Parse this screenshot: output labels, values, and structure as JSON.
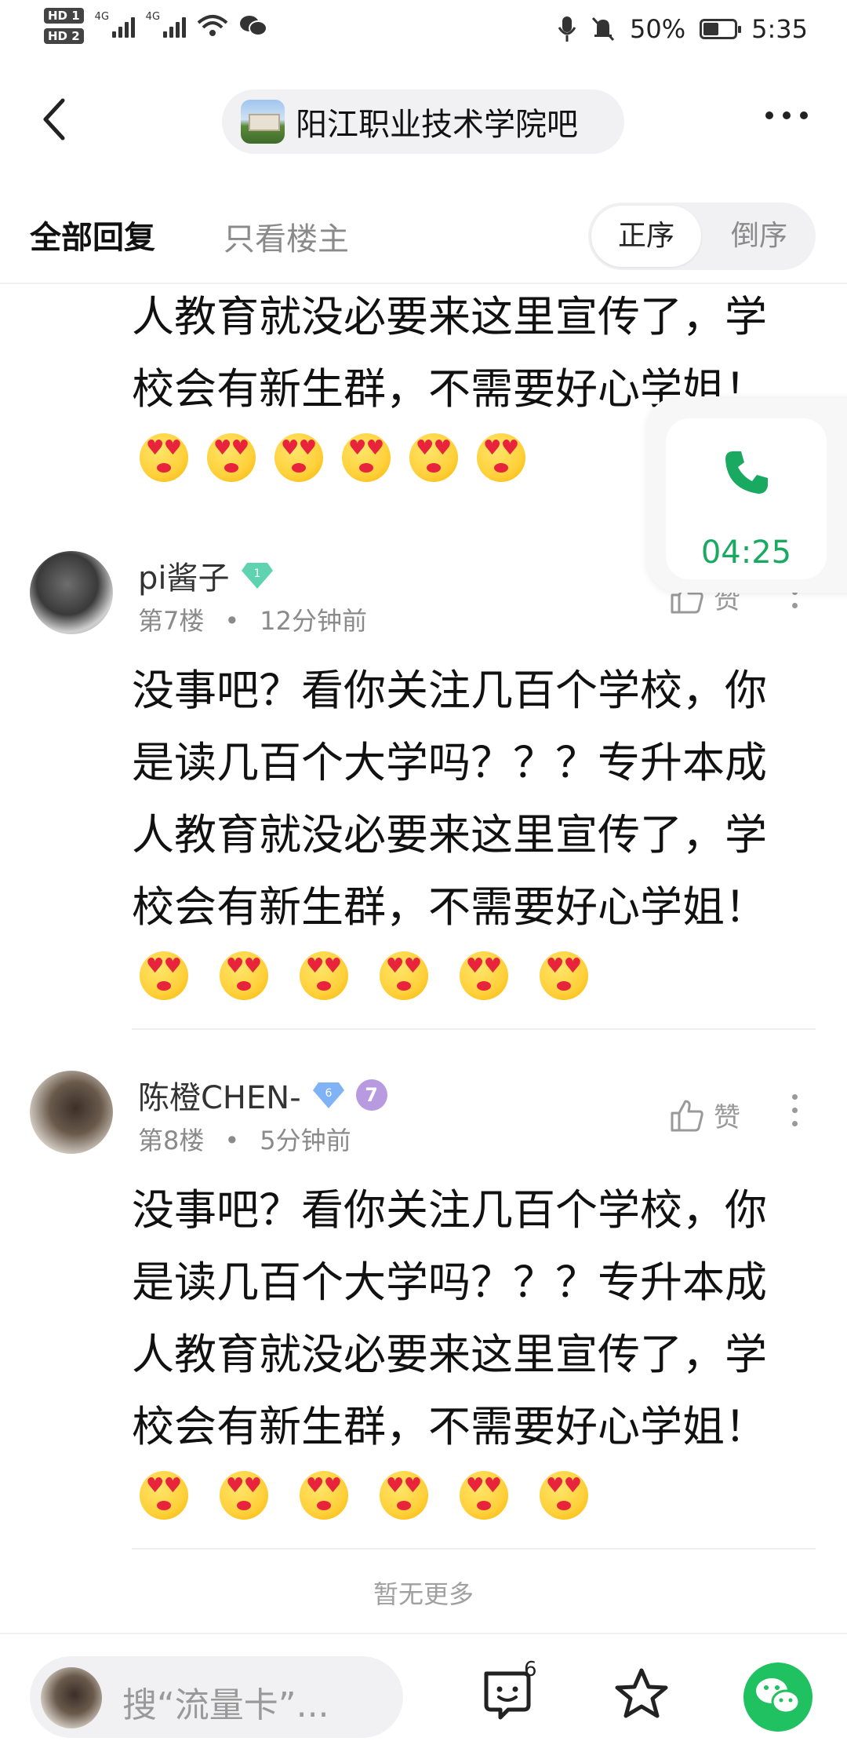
{
  "status_bar": {
    "hd1": "HD 1",
    "hd2": "HD 2",
    "net1": "4G",
    "net2": "4G",
    "battery_text": "50%",
    "battery_level": 0.5,
    "time": "5:35"
  },
  "header": {
    "forum_name": "阳江职业技术学院吧"
  },
  "tabs": {
    "all_replies": "全部回复",
    "op_only": "只看楼主",
    "sort_asc": "正序",
    "sort_desc": "倒序"
  },
  "top_fragment": {
    "lines": [
      "人教育就没必要来这里宣传了，学",
      "校会有新生群，不需要好心学姐！"
    ]
  },
  "posts": [
    {
      "username": "pi酱子",
      "level_badge": "1",
      "floor": "第7楼",
      "sep": "•",
      "time": "12分钟前",
      "like_label": "赞",
      "lines": [
        "没事吧？看你关注几百个学校，你",
        "是读几百个大学吗？？？专升本成",
        "人教育就没必要来这里宣传了，学",
        "校会有新生群，不需要好心学姐！"
      ]
    },
    {
      "username": "陈橙CHEN-",
      "level_badge": "6",
      "extra_badge": "7",
      "floor": "第8楼",
      "sep": "•",
      "time": "5分钟前",
      "like_label": "赞",
      "lines": [
        "没事吧？看你关注几百个学校，你",
        "是读几百个大学吗？？？专升本成",
        "人教育就没必要来这里宣传了，学",
        "校会有新生群，不需要好心学姐！"
      ]
    }
  ],
  "footer_note": "暂无更多",
  "call": {
    "timer": "04:25"
  },
  "bottom_bar": {
    "search_placeholder": "搜“流量卡”...",
    "emoji_badge": "6"
  },
  "colors": {
    "accent_green": "#1aa960",
    "wechat_green": "#20c160",
    "muted_gray": "#8a8a8a"
  },
  "icons": [
    "back-arrow-icon",
    "more-icon",
    "like-icon",
    "kebab-icon",
    "phone-icon",
    "emoji-face-icon",
    "star-icon",
    "wechat-icon",
    "level-diamond-icon"
  ]
}
